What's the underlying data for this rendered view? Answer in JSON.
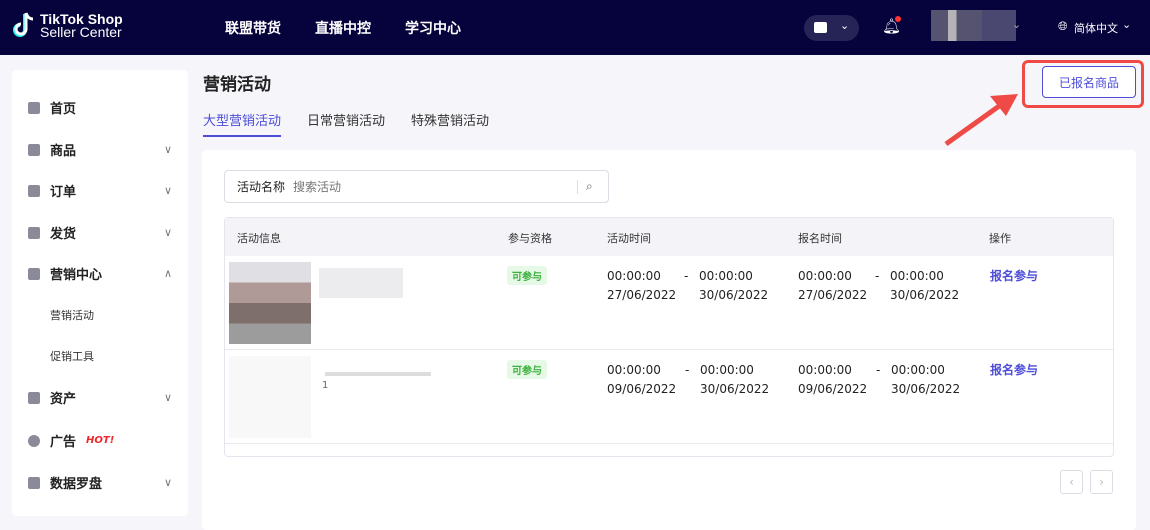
{
  "header": {
    "logo_line1": "TikTok Shop",
    "logo_line2": "Seller Center",
    "nav": [
      "联盟带货",
      "直播中控",
      "学习中心"
    ],
    "language": "简体中文"
  },
  "sidebar": {
    "items": [
      {
        "label": "首页"
      },
      {
        "label": "商品"
      },
      {
        "label": "订单"
      },
      {
        "label": "发货"
      },
      {
        "label": "营销中心"
      },
      {
        "label": "营销活动"
      },
      {
        "label": "促销工具"
      },
      {
        "label": "资产"
      },
      {
        "label": "广告",
        "badge": "HOT!"
      },
      {
        "label": "数据罗盘"
      }
    ]
  },
  "page": {
    "title": "营销活动",
    "registered_button": "已报名商品",
    "tabs": [
      "大型营销活动",
      "日常营销活动",
      "特殊营销活动"
    ]
  },
  "search": {
    "label": "活动名称",
    "placeholder": "搜索活动"
  },
  "table": {
    "columns": [
      "活动信息",
      "参与资格",
      "活动时间",
      "报名时间",
      "操作"
    ],
    "rows": [
      {
        "extra": "",
        "status": "可参与",
        "act_start": "00:00:00",
        "act_start_date": "27/06/2022",
        "act_end": "00:00:00",
        "act_end_date": "30/06/2022",
        "reg_start": "00:00:00",
        "reg_start_date": "27/06/2022",
        "reg_end": "00:00:00",
        "reg_end_date": "30/06/2022",
        "action": "报名参与"
      },
      {
        "extra": "1",
        "status": "可参与",
        "act_start": "00:00:00",
        "act_start_date": "09/06/2022",
        "act_end": "00:00:00",
        "act_end_date": "30/06/2022",
        "reg_start": "00:00:00",
        "reg_start_date": "09/06/2022",
        "reg_end": "00:00:00",
        "reg_end_date": "30/06/2022",
        "action": "报名参与"
      }
    ]
  },
  "pagination": {
    "prev": "‹",
    "next": "›"
  },
  "colors": {
    "accent": "#4d4dd9",
    "header": "#05023c",
    "highlight": "#ef4a45"
  }
}
